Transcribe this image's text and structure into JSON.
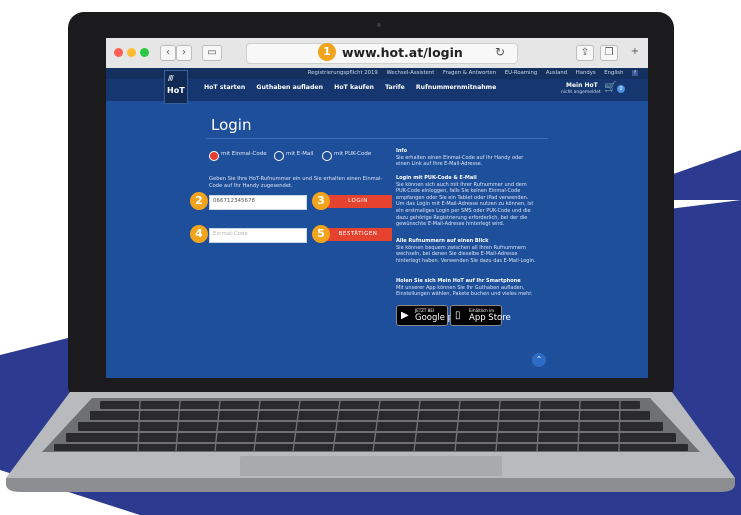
{
  "browser": {
    "url": "www.hot.at/login",
    "marker_1": "1"
  },
  "site": {
    "logo_text": "HoT",
    "top_links": [
      "Registrierungspflicht 2019",
      "Wechsel-Assistent",
      "Fragen & Antworten",
      "EU-Roaming",
      "Ausland",
      "Handys",
      "English"
    ],
    "nav": [
      "HoT starten",
      "Guthaben aufladen",
      "HoT kaufen",
      "Tarife",
      "Rufnummernmitnahme"
    ],
    "mein_hot": "Mein HoT",
    "mein_hot_sub": "nicht angemeldet",
    "cart_count": "0"
  },
  "login": {
    "title": "Login",
    "radio_options": [
      "mit Einmal-Code",
      "mit E-Mail",
      "mit PUK-Code"
    ],
    "instruction": "Geben Sie Ihre HoT-Rufnummer ein und Sie erhalten einen Einmal-Code auf Ihr Handy zugesendet.",
    "phone_value": "066712345678",
    "code_placeholder": "Einmal-Code",
    "login_button": "LOGIN",
    "confirm_button": "BESTÄTIGEN",
    "markers": [
      "2",
      "3",
      "4",
      "5"
    ]
  },
  "info": {
    "h1": "Info",
    "p1": "Sie erhalten einen Einmal-Code auf Ihr Handy oder einen Link auf Ihre E-Mail-Adresse.",
    "h2": "Login mit PUK-Code & E-Mail",
    "p2": "Sie können sich auch mit Ihrer Rufnummer und dem PUK-Code einloggen, falls Sie keinen Einmal-Code empfangen oder Sie ein Tablet oder iPad verwenden. Um das Login mit E-Mail-Adresse nutzen zu können, ist ein erstmaliges Login per SMS oder PUK-Code und die dazu gehörige Registrierung erforderlich, bei der die gewünschte E-Mail-Adresse hinterlegt wird.",
    "h3": "Alle Rufnummern auf einen Blick",
    "p3": "Sie können bequem zwischen all Ihren Rufnummern wechseln, bei denen Sie dieselbe E-Mail-Adresse hinterlegt haben. Verwenden Sie dazu das E-Mail-Login.",
    "h4": "Holen Sie sich Mein HoT auf Ihr Smartphone",
    "p4": "Mit unserer App können Sie Ihr Guthaben aufladen, Einstellungen wählen, Pakete buchen und vieles mehr.",
    "google_small": "JETZT BEI",
    "google_big": "Google play",
    "apple_small": "Erhältlich im",
    "apple_big": "App Store"
  },
  "colors": {
    "accent_red": "#e5422f",
    "marker_orange": "#f2a41c",
    "page_blue": "#1e4f9a",
    "nav_blue": "#15366f"
  }
}
